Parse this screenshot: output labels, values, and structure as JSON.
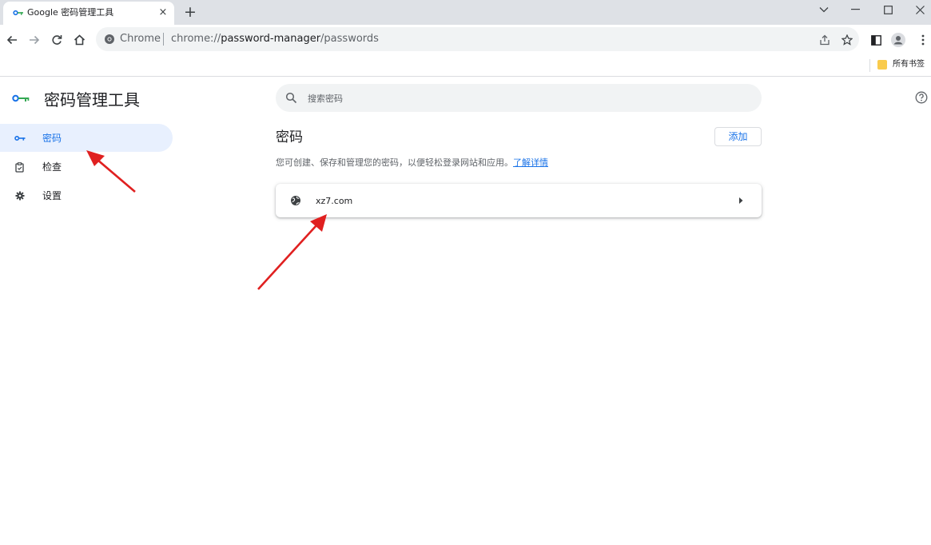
{
  "tab": {
    "title": "Google 密码管理工具",
    "close": "×",
    "new_tab": "+"
  },
  "toolbar": {
    "scheme_label": "Chrome",
    "url_prefix": "chrome://",
    "url_host": "password-manager",
    "url_path": "/passwords"
  },
  "bookmarks": {
    "folder_label": "所有书签"
  },
  "app": {
    "title": "密码管理工具"
  },
  "sidebar": {
    "items": [
      {
        "label": "密码",
        "icon": "key-icon",
        "active": true
      },
      {
        "label": "检查",
        "icon": "checkup-icon",
        "active": false
      },
      {
        "label": "设置",
        "icon": "gear-icon",
        "active": false
      }
    ]
  },
  "search": {
    "placeholder": "搜索密码"
  },
  "passwords": {
    "title": "密码",
    "add_label": "添加",
    "description": "您可创建、保存和管理您的密码，以便轻松登录网站和应用。",
    "learn_more": "了解详情",
    "sites": [
      {
        "name": "xz7.com"
      }
    ]
  },
  "colors": {
    "accent": "#1a73e8",
    "active_nav_bg": "#e8f0fe",
    "annotation_arrow": "#e02020"
  }
}
